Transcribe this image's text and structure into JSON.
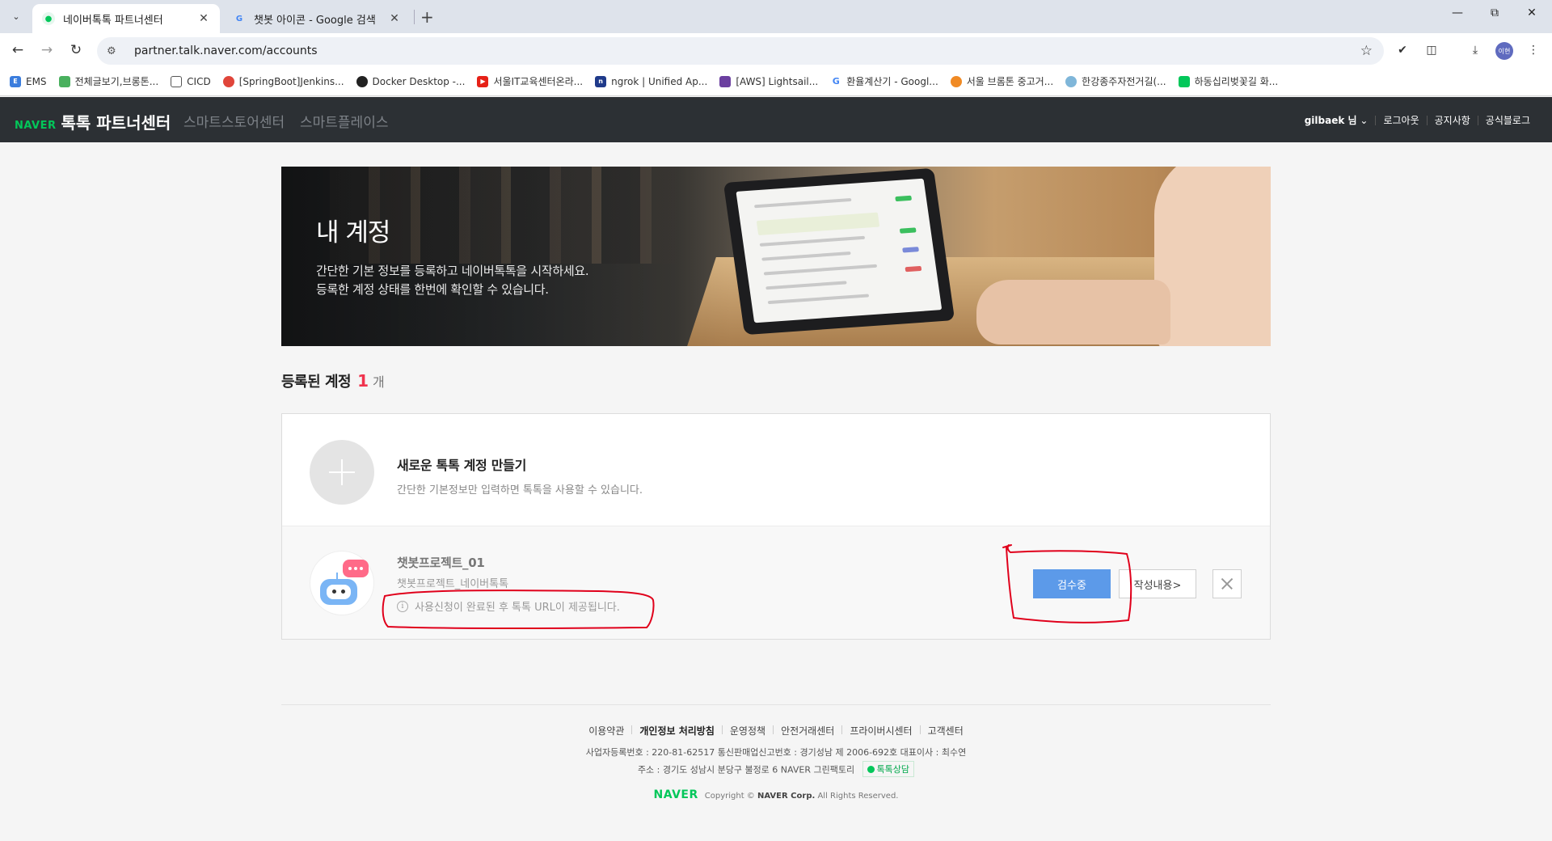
{
  "browser": {
    "tabs": [
      {
        "title": "네이버톡톡 파트너센터",
        "active": true
      },
      {
        "title": "챗봇 아이콘 - Google 검색",
        "active": false
      }
    ],
    "url": "partner.talk.naver.com/accounts",
    "profile_initials": "이현",
    "bookmarks": [
      {
        "label": "EMS",
        "icon_color": "#3b7ddd"
      },
      {
        "label": "전체글보기,브롱톤...",
        "icon_color": "#49b05e"
      },
      {
        "label": "CICD",
        "icon_color": "#555555"
      },
      {
        "label": "[SpringBoot]Jenkins...",
        "icon_color": "#e0453a"
      },
      {
        "label": "Docker Desktop -...",
        "icon_color": "#222222"
      },
      {
        "label": "서울IT교육센터온라...",
        "icon_color": "#e62117"
      },
      {
        "label": "ngrok | Unified Ap...",
        "icon_color": "#1f3a8a"
      },
      {
        "label": "[AWS] Lightsail...",
        "icon_color": "#6b3fa0"
      },
      {
        "label": "환율계산기 - Googl...",
        "icon_color": "#4285f4"
      },
      {
        "label": "서울 브롬톤 중고거...",
        "icon_color": "#f08a24"
      },
      {
        "label": "한강종주자전거길(...",
        "icon_color": "#7fb6d9"
      },
      {
        "label": "하동십리벚꽃길 화...",
        "icon_color": "#03c75a"
      }
    ]
  },
  "header": {
    "logo_naver": "NAVER",
    "logo_service": "톡톡 파트너센터",
    "nav": [
      "스마트스토어센터",
      "스마트플레이스"
    ],
    "user": "gilbaek 님",
    "links": [
      "로그아웃",
      "공지사항",
      "공식블로그"
    ]
  },
  "banner": {
    "title": "내 계정",
    "line1": "간단한 기본 정보를 등록하고 네이버톡톡을 시작하세요.",
    "line2": "등록한 계정 상태를 한번에 확인할 수 있습니다."
  },
  "accounts": {
    "heading": "등록된 계정",
    "count": "1",
    "unit": "개",
    "create_title": "새로운 톡톡 계정 만들기",
    "create_desc": "간단한 기본정보만 입력하면 톡톡을 사용할 수 있습니다.",
    "item": {
      "name": "챗봇프로젝트_01",
      "sub": "챗봇프로젝트_네이버톡톡",
      "notice": "사용신청이 완료된 후 톡톡 URL이 제공됩니다.",
      "status_button": "검수중",
      "content_button": "작성내용>"
    }
  },
  "footer": {
    "links": [
      "이용약관",
      "개인정보 처리방침",
      "운영정책",
      "안전거래센터",
      "프라이버시센터",
      "고객센터"
    ],
    "biz_info": "사업자등록번호 : 220-81-62517 통신판매업신고번호 : 경기성남 제 2006-692호 대표이사 : 최수연",
    "address": "주소 : 경기도 성남시 분당구 불정로 6 NAVER 그린팩토리",
    "chat_badge": "톡톡상담",
    "copyright_prefix": "Copyright ©",
    "copyright_company": "NAVER Corp.",
    "copyright_suffix": "All Rights Reserved.",
    "logo": "NAVER"
  },
  "colors": {
    "naver_green": "#03c75a",
    "header_bg": "#2c3034",
    "count_red": "#f0334d",
    "review_button": "#5c9ae9",
    "annotation_red": "#e0001b"
  }
}
